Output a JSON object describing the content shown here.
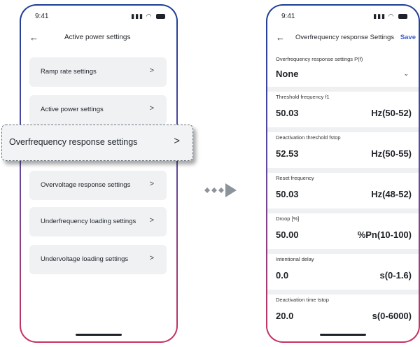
{
  "status": {
    "time": "9:41",
    "signal_icon": "signal-icon",
    "wifi_icon": "wifi-icon",
    "battery_icon": "battery-icon"
  },
  "left_screen": {
    "title": "Active power settings",
    "menu": [
      {
        "label": "Ramp rate settings",
        "chevron": ">"
      },
      {
        "label": "Active power settings",
        "chevron": ">"
      },
      {
        "label": "Overvoltage response settings",
        "chevron": ">"
      },
      {
        "label": "Underfrequency loading settings",
        "chevron": ">"
      },
      {
        "label": "Undervoltage loading settings",
        "chevron": ">"
      }
    ],
    "highlighted": {
      "label": "Overfrequency response settings",
      "chevron": ">"
    }
  },
  "right_screen": {
    "title": "Overfrequency response Settings",
    "save_label": "Save",
    "mode": {
      "label": "Overfrequency response settings P(f)",
      "value": "None",
      "chevron": "⌄"
    },
    "fields": [
      {
        "label": "Threshold frequency f1",
        "value": "50.03",
        "range": "Hz(50-52)"
      },
      {
        "label": "Deactivation threshold fstop",
        "value": "52.53",
        "range": "Hz(50-55)"
      },
      {
        "label": "Reset frequency",
        "value": "50.03",
        "range": "Hz(48-52)"
      },
      {
        "label": "Droop [%]",
        "value": "50.00",
        "range": "%Pn(10-100)"
      },
      {
        "label": "Intentional delay",
        "value": "0.0",
        "range": "s(0-1.6)"
      },
      {
        "label": "Deactivation time tstop",
        "value": "20.0",
        "range": "s(0-6000)"
      }
    ]
  },
  "colors": {
    "accent": "#3d5bd6",
    "card_bg": "#eff1f3",
    "arrow": "#8d939b",
    "frame_top": "#1c3f95",
    "frame_bottom": "#c8325e"
  }
}
